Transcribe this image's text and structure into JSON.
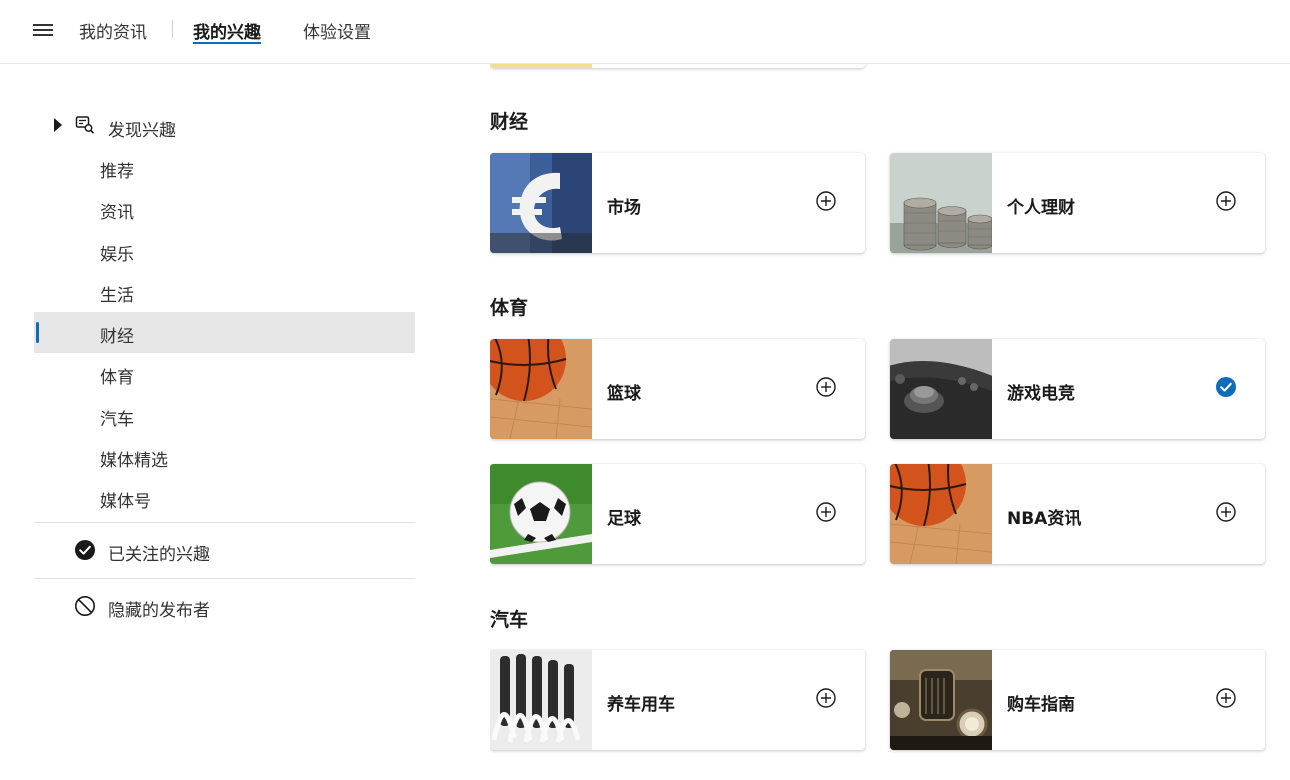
{
  "topnav": {
    "tabs": [
      {
        "label": "我的资讯",
        "active": false
      },
      {
        "label": "我的兴趣",
        "active": true
      },
      {
        "label": "体验设置",
        "active": false
      }
    ]
  },
  "sidebar": {
    "discover_label": "发现兴趣",
    "categories": [
      {
        "label": "推荐",
        "active": false
      },
      {
        "label": "资讯",
        "active": false
      },
      {
        "label": "娱乐",
        "active": false
      },
      {
        "label": "生活",
        "active": false
      },
      {
        "label": "财经",
        "active": true
      },
      {
        "label": "体育",
        "active": false
      },
      {
        "label": "汽车",
        "active": false
      },
      {
        "label": "媒体精选",
        "active": false
      },
      {
        "label": "媒体号",
        "active": false
      }
    ],
    "followed_label": "已关注的兴趣",
    "hidden_label": "隐藏的发布者"
  },
  "sections": [
    {
      "title": "财经",
      "cards": [
        {
          "name": "市场",
          "followed": false,
          "icon": "add-circle-icon"
        },
        {
          "name": "个人理财",
          "followed": false,
          "icon": "add-circle-icon"
        }
      ]
    },
    {
      "title": "体育",
      "cards": [
        {
          "name": "篮球",
          "followed": false,
          "icon": "add-circle-icon"
        },
        {
          "name": "游戏电竞",
          "followed": true,
          "icon": "checkmark-circle-icon"
        },
        {
          "name": "足球",
          "followed": false,
          "icon": "add-circle-icon"
        },
        {
          "name": "NBA资讯",
          "followed": false,
          "icon": "add-circle-icon"
        }
      ]
    },
    {
      "title": "汽车",
      "cards": [
        {
          "name": "养车用车",
          "followed": false,
          "icon": "add-circle-icon"
        },
        {
          "name": "购车指南",
          "followed": false,
          "icon": "add-circle-icon"
        }
      ]
    }
  ],
  "colors": {
    "accent": "#0f6cbd",
    "active_row": "#e6e6e6"
  }
}
